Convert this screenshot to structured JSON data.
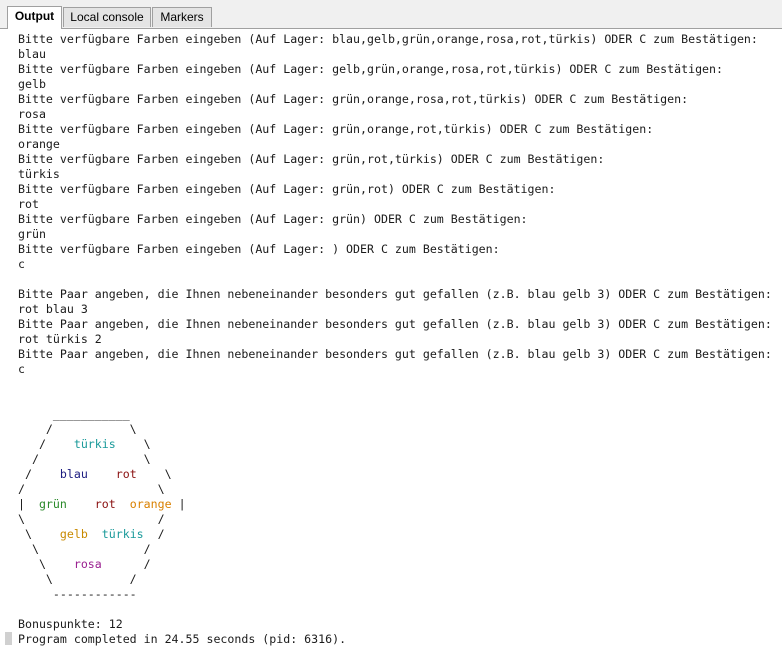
{
  "tabs": [
    {
      "label": "Output",
      "active": true
    },
    {
      "label": "Local console",
      "active": false
    },
    {
      "label": "Markers",
      "active": false
    }
  ],
  "colors": {
    "tuerkis": "#1a9a9a",
    "blau": "#1c1c80",
    "rot": "#8a1010",
    "gruen": "#2a8a2a",
    "orange": "#d98000",
    "gelb": "#c88a00",
    "rosa": "#9a2090",
    "text": "#1a1a1a"
  },
  "console": {
    "lines": [
      "Bitte verfügbare Farben eingeben (Auf Lager: blau,gelb,grün,orange,rosa,rot,türkis) ODER C zum Bestätigen:",
      "blau",
      "Bitte verfügbare Farben eingeben (Auf Lager: gelb,grün,orange,rosa,rot,türkis) ODER C zum Bestätigen:",
      "gelb",
      "Bitte verfügbare Farben eingeben (Auf Lager: grün,orange,rosa,rot,türkis) ODER C zum Bestätigen:",
      "rosa",
      "Bitte verfügbare Farben eingeben (Auf Lager: grün,orange,rot,türkis) ODER C zum Bestätigen:",
      "orange",
      "Bitte verfügbare Farben eingeben (Auf Lager: grün,rot,türkis) ODER C zum Bestätigen:",
      "türkis",
      "Bitte verfügbare Farben eingeben (Auf Lager: grün,rot) ODER C zum Bestätigen:",
      "rot",
      "Bitte verfügbare Farben eingeben (Auf Lager: grün) ODER C zum Bestätigen:",
      "grün",
      "Bitte verfügbare Farben eingeben (Auf Lager: ) ODER C zum Bestätigen:",
      "c",
      "",
      "Bitte Paar angeben, die Ihnen nebeneinander besonders gut gefallen (z.B. blau gelb 3) ODER C zum Bestätigen:",
      "rot blau 3",
      "Bitte Paar angeben, die Ihnen nebeneinander besonders gut gefallen (z.B. blau gelb 3) ODER C zum Bestätigen:",
      "rot türkis 2",
      "Bitte Paar angeben, die Ihnen nebeneinander besonders gut gefallen (z.B. blau gelb 3) ODER C zum Bestätigen:",
      "c",
      "",
      ""
    ],
    "hexagon": [
      [
        {
          "t": "     ___________"
        }
      ],
      [
        {
          "t": "    /           \\"
        }
      ],
      [
        {
          "t": "   /    "
        },
        {
          "t": "türkis",
          "k": "tuerkis"
        },
        {
          "t": "    \\"
        }
      ],
      [
        {
          "t": "  /               \\"
        }
      ],
      [
        {
          "t": " /    "
        },
        {
          "t": "blau",
          "k": "blau"
        },
        {
          "t": "    "
        },
        {
          "t": "rot",
          "k": "rot"
        },
        {
          "t": "    \\"
        }
      ],
      [
        {
          "t": "/                   \\"
        }
      ],
      [
        {
          "t": "|  "
        },
        {
          "t": "grün",
          "k": "gruen"
        },
        {
          "t": "    "
        },
        {
          "t": "rot",
          "k": "rot"
        },
        {
          "t": "  "
        },
        {
          "t": "orange",
          "k": "orange"
        },
        {
          "t": " |"
        }
      ],
      [
        {
          "t": "\\                   /"
        }
      ],
      [
        {
          "t": " \\    "
        },
        {
          "t": "gelb",
          "k": "gelb"
        },
        {
          "t": "  "
        },
        {
          "t": "türkis",
          "k": "tuerkis"
        },
        {
          "t": "  /"
        }
      ],
      [
        {
          "t": "  \\               /"
        }
      ],
      [
        {
          "t": "   \\    "
        },
        {
          "t": "rosa",
          "k": "rosa"
        },
        {
          "t": "      /"
        }
      ],
      [
        {
          "t": "    \\           /"
        }
      ],
      [
        {
          "t": "     ------------"
        }
      ]
    ],
    "after": [
      "",
      "Bonuspunkte: 12",
      "Program completed in 24.55 seconds (pid: 6316)."
    ]
  }
}
